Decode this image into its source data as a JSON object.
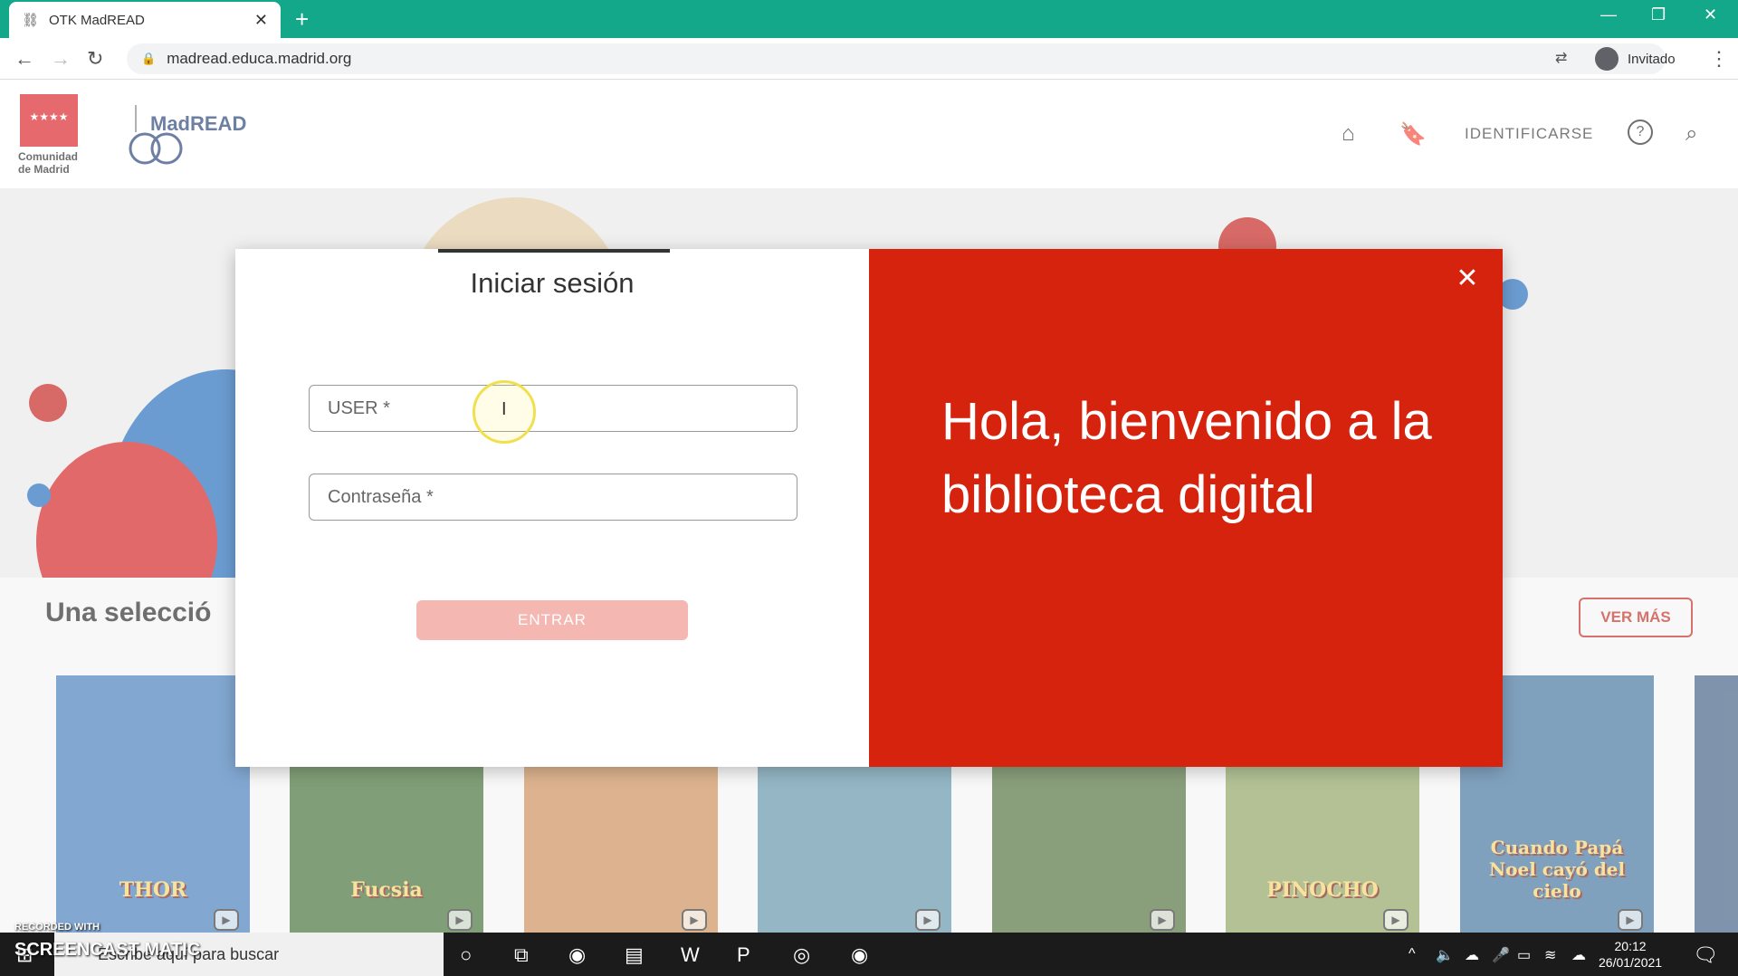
{
  "browser": {
    "tab_title": "OTK MadREAD",
    "url": "madread.educa.madrid.org",
    "profile_label": "Invitado"
  },
  "header": {
    "logo_cam_text": "Comunidad de Madrid",
    "logo_madread_text": "MadREAD",
    "identify_link": "IDENTIFICARSE"
  },
  "section": {
    "title": "Una selecció",
    "see_more": "VER MÁS"
  },
  "covers": [
    {
      "title": "THOR",
      "color": "#3f79b8"
    },
    {
      "title": "Fucsia",
      "color": "#3c6b2f"
    },
    {
      "title": "",
      "color": "#c98b52"
    },
    {
      "title": "",
      "color": "#5b8fa7"
    },
    {
      "title": "",
      "color": "#4a6b35"
    },
    {
      "title": "PINOCHO",
      "color": "#8aa05c"
    },
    {
      "title": "Cuando Papá Noel cayó del cielo",
      "color": "#3c6f9c"
    }
  ],
  "login": {
    "title": "Iniciar sesión",
    "user_placeholder": "USER *",
    "password_placeholder": "Contraseña *",
    "submit_label": "ENTRAR"
  },
  "welcome": {
    "text": "Hola, bienvenido a la biblioteca digital"
  },
  "taskbar": {
    "search_placeholder": "Escribe aquí para buscar",
    "time": "20:12",
    "date": "26/01/2021"
  },
  "watermark": {
    "line1": "RECORDED WITH",
    "line2": "SCREENCAST MATIC"
  }
}
